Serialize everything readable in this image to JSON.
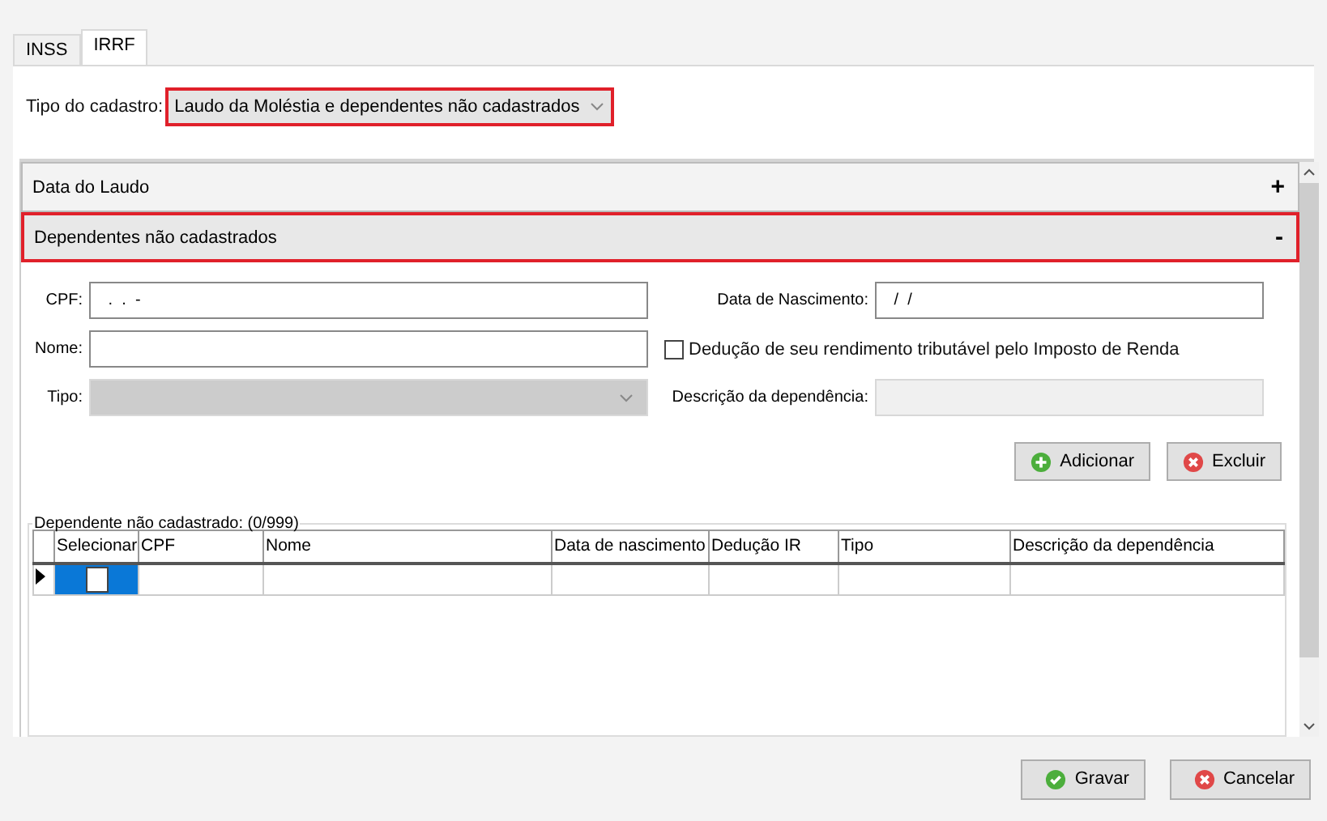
{
  "tabs": [
    {
      "label": "INSS",
      "selected": false
    },
    {
      "label": "IRRF",
      "selected": true
    }
  ],
  "tipo_cadastro": {
    "label": "Tipo do cadastro:",
    "value": "Laudo da Moléstia e dependentes não cadastrados",
    "highlighted": true
  },
  "sections": [
    {
      "title": "Data do Laudo",
      "toggle": "+",
      "highlighted": false
    },
    {
      "title": "Dependentes não cadastrados",
      "toggle": "-",
      "highlighted": true,
      "form": {
        "cpf": {
          "label": "CPF:",
          "value": " .  .  -"
        },
        "nascimento": {
          "label": "Data de Nascimento:",
          "value": " /  /"
        },
        "nome": {
          "label": "Nome:"
        },
        "deducao": {
          "label": "Dedução de seu rendimento tributável pelo Imposto de Renda",
          "checked": false
        },
        "tipo": {
          "label": "Tipo:",
          "disabled": true
        },
        "descricao": {
          "label": "Descrição da dependência:",
          "disabled": true
        }
      },
      "form_buttons": [
        {
          "label": "Adicionar",
          "kind": "add"
        },
        {
          "label": "Excluir",
          "kind": "delete"
        }
      ],
      "grid": {
        "title": "Dependente não cadastrado: (0/999)",
        "columns": [
          "Selecionar",
          "CPF",
          "Nome",
          "Data de nascimento",
          "Dedução IR",
          "Tipo",
          "Descrição da dependência"
        ],
        "rows": [
          {
            "current": true,
            "checked": false
          }
        ]
      }
    }
  ],
  "footer_buttons": [
    {
      "label": "Gravar",
      "kind": "ok"
    },
    {
      "label": "Cancelar",
      "kind": "delete"
    }
  ]
}
